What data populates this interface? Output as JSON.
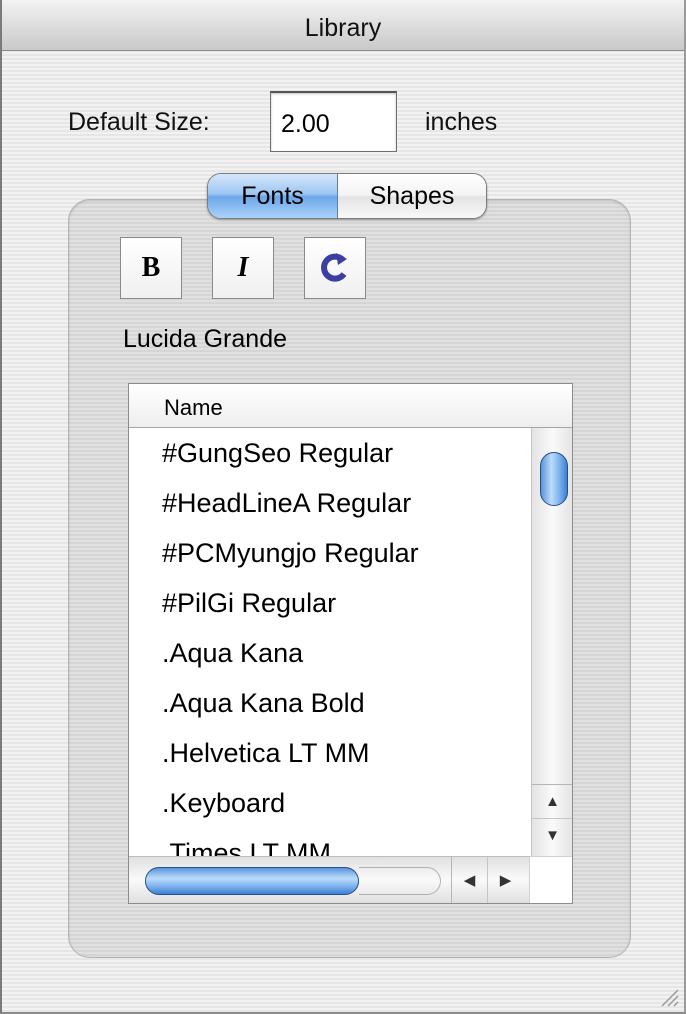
{
  "window": {
    "title": "Library"
  },
  "default_size": {
    "label": "Default Size:",
    "value": "2.00",
    "unit": "inches"
  },
  "tabs": [
    {
      "label": "Fonts",
      "selected": true
    },
    {
      "label": "Shapes",
      "selected": false
    }
  ],
  "toolbar": {
    "bold_label": "B",
    "italic_label": "I",
    "refresh_icon": "refresh-icon"
  },
  "selected_font": "Lucida Grande",
  "font_list": {
    "column_header": "Name",
    "rows": [
      "#GungSeo Regular",
      "#HeadLineA Regular",
      "#PCMyungjo Regular",
      "#PilGi Regular",
      ".Aqua Kana",
      ".Aqua Kana Bold",
      ".Helvetica LT MM",
      ".Keyboard",
      ".Times LT MM"
    ]
  },
  "colors": {
    "accent": "#6ea6e8",
    "refresh_icon": "#3b3ea3"
  }
}
